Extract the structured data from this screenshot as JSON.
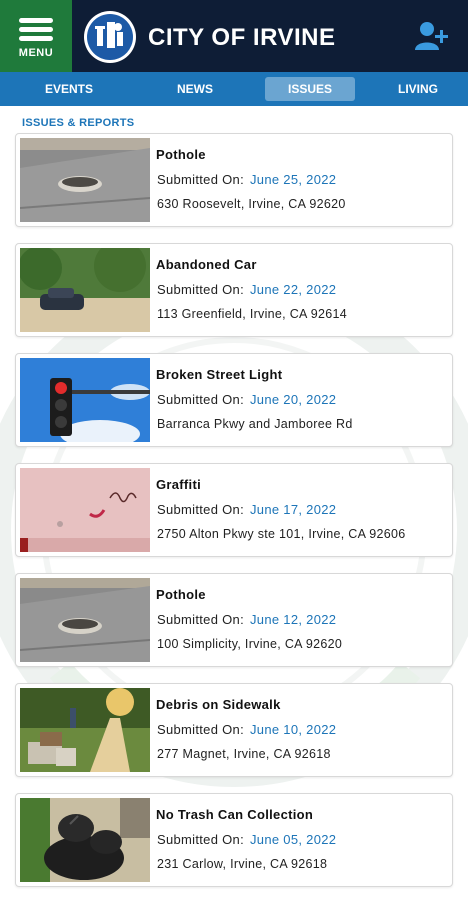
{
  "header": {
    "menu_label": "MENU",
    "title": "CITY OF IRVINE",
    "brand_color": "#0e1d36",
    "menu_color": "#1f7a3b",
    "icons": {
      "menu": "hamburger-icon",
      "logo": "city-seal-logo",
      "user": "add-user-icon"
    }
  },
  "tabs": [
    {
      "label": "EVENTS",
      "active": false
    },
    {
      "label": "NEWS",
      "active": false
    },
    {
      "label": "ISSUES",
      "active": true
    },
    {
      "label": "LIVING",
      "active": false
    }
  ],
  "section_label": "ISSUES & REPORTS",
  "accent_color": "#1d75b8",
  "submitted_label": "Submitted On:",
  "issues": [
    {
      "title": "Pothole",
      "date": "June 25, 2022",
      "address": "630 Roosevelt, Irvine, CA 92620",
      "image": "pothole-photo"
    },
    {
      "title": "Abandoned Car",
      "date": "June 22, 2022",
      "address": "113 Greenfield, Irvine, CA 92614",
      "image": "abandoned-car-photo"
    },
    {
      "title": "Broken Street Light",
      "date": "June 20, 2022",
      "address": "Barranca Pkwy and Jamboree Rd",
      "image": "traffic-light-photo"
    },
    {
      "title": "Graffiti",
      "date": "June 17, 2022",
      "address": "2750 Alton Pkwy ste 101, Irvine, CA 92606",
      "image": "graffiti-photo"
    },
    {
      "title": "Pothole",
      "date": "June 12, 2022",
      "address": "100 Simplicity, Irvine, CA 92620",
      "image": "pothole-photo"
    },
    {
      "title": "Debris on Sidewalk",
      "date": "June 10, 2022",
      "address": "277 Magnet, Irvine, CA 92618",
      "image": "sidewalk-debris-photo"
    },
    {
      "title": "No Trash Can Collection",
      "date": "June 05, 2022",
      "address": "231 Carlow, Irvine, CA 92618",
      "image": "trash-bags-photo"
    }
  ]
}
